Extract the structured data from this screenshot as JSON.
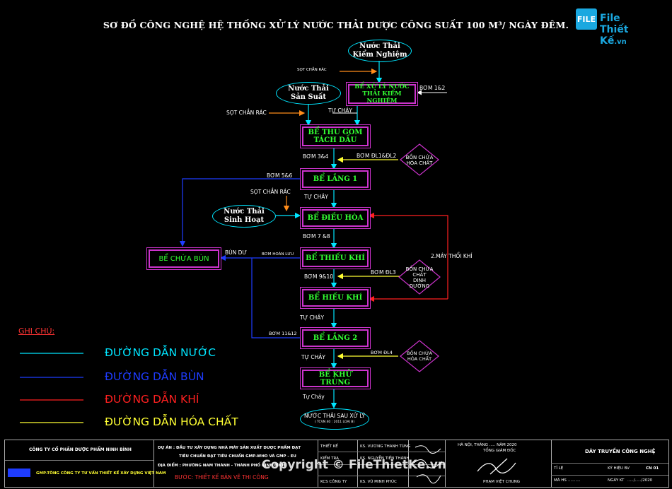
{
  "title": "SƠ ĐỒ CÔNG NGHỆ HỆ THỐNG XỬ LÝ NƯỚC THẢI DƯỢC CÔNG SUẤT 100 M³/ NGÀY ĐÊM.",
  "logo": {
    "brand": "File Thiết Kế",
    "suffix": ".vn",
    "mark": "FILE"
  },
  "sources": {
    "kiem_nghiem": [
      "Nước Thải",
      "Kiểm Nghiệm"
    ],
    "san_xuat": [
      "Nước Thải",
      "Sản Suất"
    ],
    "sinh_hoat": [
      "Nước Thải",
      "Sinh Hoạt"
    ],
    "output": [
      "NƯỚC THẢI SAU XỬ LÝ",
      "( TCVN 40 : 2011 LOẠI B)"
    ]
  },
  "tanks": {
    "kiem_nghiem": [
      "BỂ XỬ LÝ NƯỚC",
      "THẢI KIỂM NGHIỆM"
    ],
    "thu_gom": [
      "BỂ THU GOM",
      "TÁCH DẦU"
    ],
    "lang1": "BỂ LẮNG 1",
    "dieu_hoa": "BỂ ĐIỀU HÒA",
    "thieu_khi": "BỂ THIẾU KHÍ",
    "hieu_khi": "BỂ HIẾU KHÍ",
    "lang2": "BỂ LẮNG 2",
    "khu_trung": "BỂ KHỬ TRÙNG",
    "chua_bun": "BỂ CHỨA BÙN"
  },
  "chemicals": {
    "hoa_chat_1": [
      "BỒN CHỨA",
      "HÓA CHẤT"
    ],
    "dinh_duong": [
      "BỒN CHỨA",
      "CHẤT",
      "DINH",
      "DƯỠNG"
    ],
    "hoa_chat_2": [
      "BỒN CHỨA",
      "HÓA CHẤT"
    ]
  },
  "labels": {
    "sot1": "SỌT CHẮN RÁC",
    "sot2": "SỌT CHẮN RÁC",
    "sot3": "SỌT CHẮN RÁC",
    "bom12": "BƠM 1&2",
    "tu_chay1": "TỰ CHẢY",
    "bom34": "BƠM 3&4",
    "bom_dl12": "BƠM ĐL1&ĐL2",
    "bom56": "BƠM 5&6",
    "tu_chay2": "TỰ CHẢY",
    "bom78": "BƠM 7 &8",
    "bun_du": "BÙN DƯ",
    "bun_tuan_hoan": "BƠM HOÀN LƯU",
    "may_thoi_khi": "2.MÁY THỔI KHÍ",
    "bom_dl3": "BƠM ĐL3",
    "bom910": "BƠM 9&10",
    "tu_chay3": "TỰ CHẢY",
    "bom1112": "BƠM 11&12",
    "bom_dl4": "BƠM ĐL4",
    "tu_chay4": "TỰ CHẢY",
    "tu_chay5": "Tự Chảy"
  },
  "legend": {
    "heading": "GHI CHÚ:",
    "items": [
      {
        "label": "ĐƯỜNG DẪN NƯỚC",
        "color": "#00e5ff"
      },
      {
        "label": "ĐƯỜNG DẪN BÙN",
        "color": "#1e3cff"
      },
      {
        "label": "ĐƯỜNG DẪN KHÍ",
        "color": "#ff2020"
      },
      {
        "label": "ĐƯỜNG DẪN HÓA CHẤT",
        "color": "#ffff33"
      }
    ]
  },
  "colors": {
    "water": "#00e5ff",
    "sludge": "#1e3cff",
    "air": "#ff2020",
    "chem": "#ffff33",
    "screen": "#ff8c1a",
    "tank": "#cc33cc",
    "white": "#ffffff"
  },
  "title_block": {
    "company": "CÔNG TY CỔ PHẦN DƯỢC PHẨM NINH BÌNH",
    "consultant": "GMP-TÔNG CÔNG TY TƯ VẤN THIẾT KẾ XÂY DỰNG VIỆT NAM",
    "project_1": "DỰ ÁN : ĐẦU TƯ XÂY DỰNG NHÀ MÁY SẢN XUẤT DƯỢC PHẨM ĐẠT",
    "project_2": "TIÊU CHUẨN ĐẠT TIÊU CHUẨN GMP-WHO VÀ GMP - EU",
    "location": "ĐỊA ĐIỂM : PHƯỜNG NAM THÀNH - THÀNH PHỐ NINH BÌNH",
    "stage": "BƯỚC: THIẾT KẾ BẢN VẼ THI CÔNG",
    "role_1": "THIẾT KẾ",
    "name_1": "KS. VƯƠNG THANH TÙNG",
    "role_2": "KIỂM TRA",
    "name_2": "KS. NGUYỄN TIẾN THÀNH",
    "role_3": "KCS CÔNG TY",
    "name_3": "KS. VŨ MINH PHÚC",
    "date": "HÀ NỘI, THÁNG ..... NĂM 2020",
    "director_title": "TỔNG GIÁM ĐỐC",
    "director_name": "PHẠM VIỆT CHUNG",
    "drawing_title": "DÂY TRUYỀN CÔNG NGHỆ",
    "scale_label": "TỈ LỆ",
    "symbol_label": "KÝ HIỆU BV",
    "symbol_value": "CN 01",
    "code_label": "MÃ HS",
    "code_value": "..........",
    "dates_label": "NGÀY KT",
    "dates_value": "...../...../2020"
  },
  "watermark": "Copyright © FileThietKe.vn"
}
